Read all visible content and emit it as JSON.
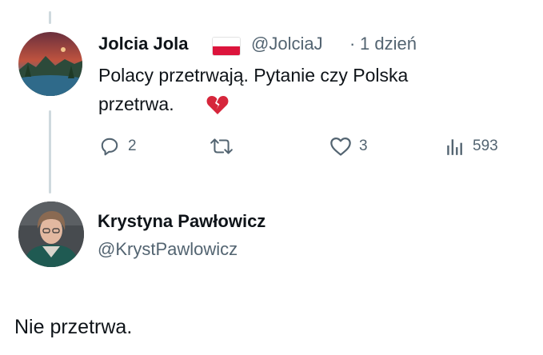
{
  "reply_tweet": {
    "display_name": "Jolcia Jola",
    "flag_icon": "poland-flag-icon",
    "handle": "@JolciaJ",
    "separator": "·",
    "time": "1 dzień",
    "text_line1": "Polacy przetrwają. Pytanie czy Polska",
    "text_line2": "przetrwa.",
    "emoji_icon": "broken-heart-icon",
    "actions": {
      "reply_count": "2",
      "retweet_count": "",
      "like_count": "3",
      "views_count": "593"
    }
  },
  "main_tweet": {
    "display_name": "Krystyna Pawłowicz",
    "handle": "@KrystPawlowicz",
    "text": "Nie przetrwa."
  },
  "colors": {
    "text_primary": "#0f1419",
    "text_secondary": "#536471",
    "thread_line": "#cfd9de",
    "heart_red": "#d6263b"
  }
}
